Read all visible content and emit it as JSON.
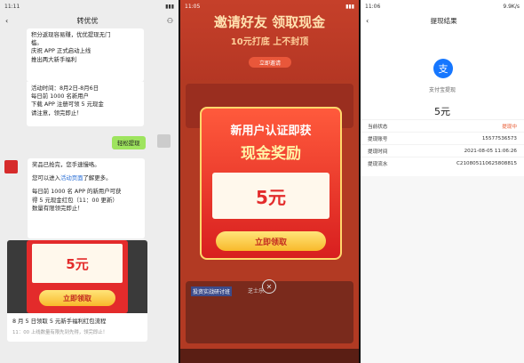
{
  "p1": {
    "time": "11:11",
    "title": "转优优",
    "bubble1": [
      "积分返现容易赚，优优提现无门",
      "槛。",
      "庆祝 APP 正式启动上线",
      "推出两大新手福利"
    ],
    "bubble2": [
      "活动时间：8月2日-8月6日",
      "每日前 1000 名新用户",
      "下载 APP 注册可领 5 元现金",
      "请注意，领完即止！"
    ],
    "reply": "轻松提现",
    "msg1": "奖品已抢完，您手速慢咯。",
    "msg2a": "您可以进入",
    "msg2link": "活动页面",
    "msg2b": "了解更多。",
    "msg3": [
      "每日前 1000 名 APP 的新用户可获",
      "得 5 元现金红包（11：00 更新）",
      "数量有限领完即止！"
    ],
    "amount": "5元",
    "btn": "立即领取",
    "cardTitle": "8 月 5 日领取 5 元新手福利红包流程",
    "cardSub": "11：00 上线数量有限先到先得，领完即止！"
  },
  "p2": {
    "time": "11:05",
    "h1": "邀请好友 领取现金",
    "h2": "10元打底 上不封顶",
    "invite": "立即邀请",
    "mt1": "新用户认证即获",
    "mt2": "现金奖励",
    "amount": "5元",
    "btn": "立即领取",
    "close": "✕",
    "cardT": "芝士乐",
    "cardS": "投资实战研讨班"
  },
  "p3": {
    "time": "11:06",
    "net": "9.9K/s",
    "title": "提现结果",
    "logo": "支",
    "sub": "支付宝提现",
    "amount": "5元",
    "rows": [
      {
        "k": "当前状态",
        "v": "提现中"
      },
      {
        "k": "提现账号",
        "v": "15577536573"
      },
      {
        "k": "提现时间",
        "v": "2021-08-05 11:06:26"
      },
      {
        "k": "提现流水",
        "v": "C210805110625808815"
      }
    ],
    "statusColor": "#e8552b"
  }
}
